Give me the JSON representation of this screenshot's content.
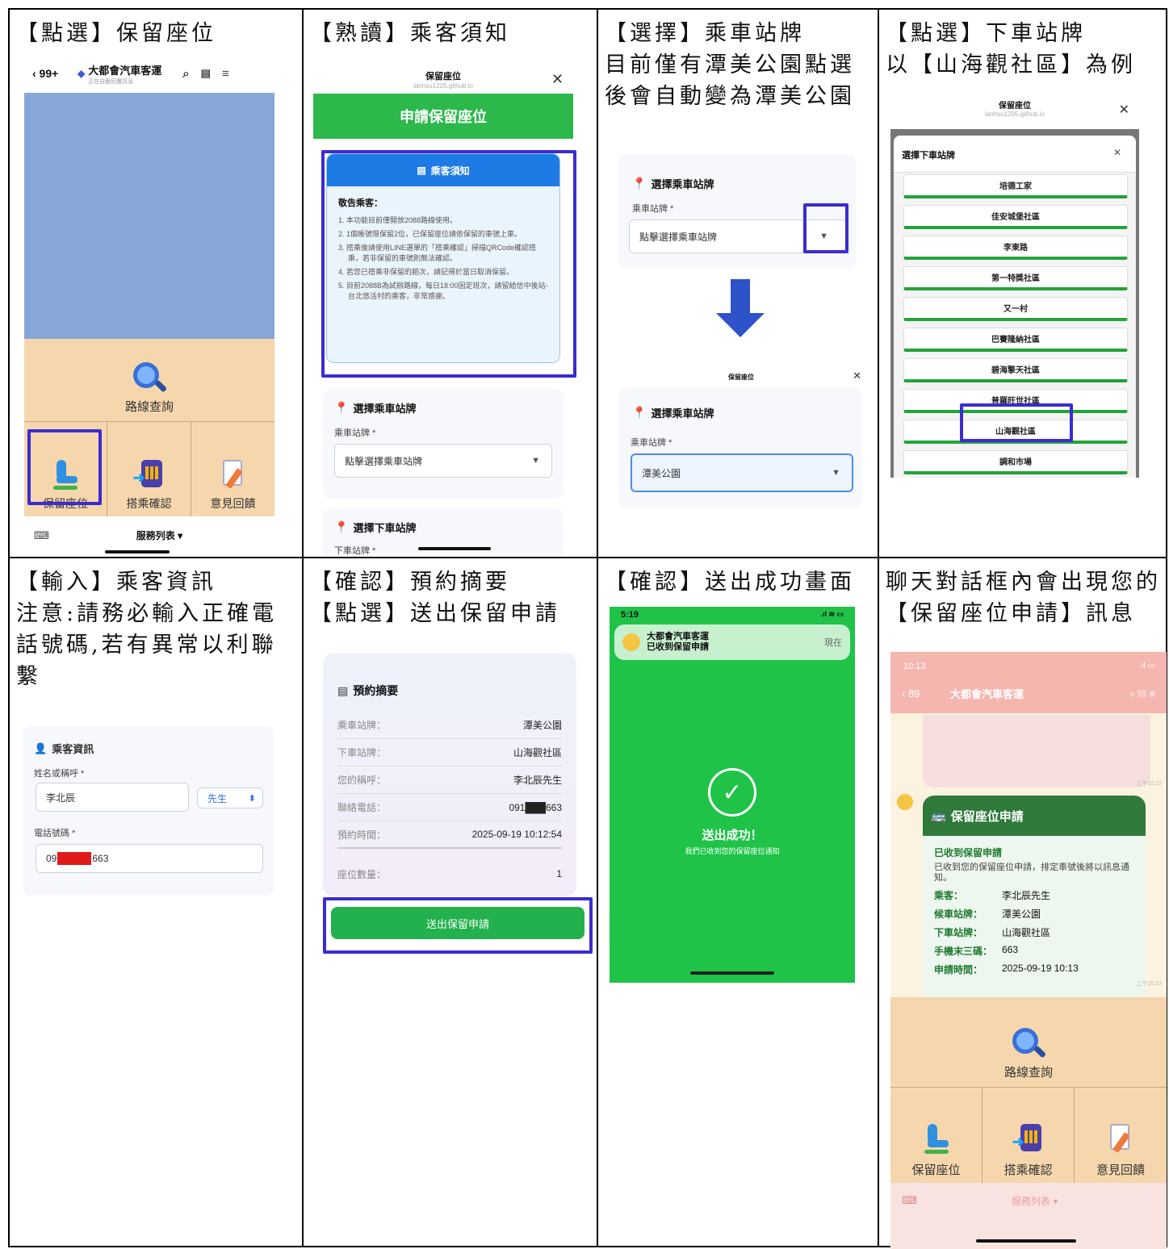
{
  "captions": {
    "c1": "【點選】保留座位",
    "c2": "【熟讀】乘客須知",
    "c3": "【選擇】乘車站牌\n目前僅有潭美公園點選後會自動變為潭美公園",
    "c4": "【點選】下車站牌\n以【山海觀社區】為例",
    "c5": "【輸入】乘客資訊\n注意:請務必輸入正確電話號碼,若有異常以利聯繫",
    "c6": "【確認】預約摘要\n【點選】送出保留申請",
    "c7": "【確認】送出成功畫面",
    "c8": "聊天對話框內會出現您的【保留座位申請】訊息"
  },
  "line_home": {
    "back": "‹ 99+",
    "account": "大都會汽車客運",
    "account_sub": "正在自動回覆訊息",
    "route_search": "路線查詢",
    "reserve": "保留座位",
    "boarding": "搭乘確認",
    "feedback": "意見回饋",
    "service_list": "服務列表 ▾"
  },
  "notice": {
    "modal_title": "保留座位",
    "modal_domain": "lanhsu1205.github.io",
    "header": "申請保留座位",
    "box_title": "乘客須知",
    "greeting": "敬告乘客：",
    "items": [
      "1. 本功能目前僅開放2088路線使用。",
      "2. 1個帳號限保留2位，已保留座位請依保留的車號上車。",
      "3. 搭乘後請使用LINE選單的「搭乘確認」掃描QRCode確認搭乘，若非保留的車號則無法確認。",
      "4. 若您已搭乘非保留的趟次，請記得於當日取消保留。",
      "5. 目前2088B為試辦路線，每日18:00固定班次，請留給信中後站-台北悠活村的乘客，非常感謝。"
    ],
    "board_section": "選擇乘車站牌",
    "board_label": "乘車站牌 *",
    "board_placeholder": "點擊選擇乘車站牌",
    "alight_section": "選擇下車站牌",
    "alight_label": "下車站牌 *"
  },
  "board_select": {
    "section": "選擇乘車站牌",
    "label": "乘車站牌 *",
    "placeholder": "點擊選擇乘車站牌",
    "modal_title": "保留座位",
    "selected": "潭美公園"
  },
  "alight_select": {
    "modal_title": "保留座位",
    "modal_domain": "lanhsu1205.github.io",
    "sheet_title": "選擇下車站牌",
    "stops": [
      "培德工家",
      "佳安城堡社區",
      "李東路",
      "第一特獎社區",
      "又一村",
      "巴賽隆納社區",
      "碧海擎天社區",
      "普羅旺世社區",
      "山海觀社區",
      "調和市場"
    ]
  },
  "passenger": {
    "section": "乘客資訊",
    "name_label": "姓名或稱呼 *",
    "name_value": "李北辰",
    "title_value": "先生",
    "phone_label": "電話號碼 *",
    "phone_prefix": "09",
    "phone_suffix": "663"
  },
  "summary": {
    "title": "預約摘要",
    "rows": [
      {
        "k": "乘車站牌：",
        "v": "潭美公園"
      },
      {
        "k": "下車站牌：",
        "v": "山海觀社區"
      },
      {
        "k": "您的稱呼：",
        "v": "李北辰先生"
      },
      {
        "k": "聯絡電話：",
        "v": "091███663"
      },
      {
        "k": "預約時間：",
        "v": "2025-09-19 10:12:54"
      }
    ],
    "seats_label": "座位數量：",
    "seats_value": "1",
    "submit": "送出保留申請"
  },
  "success": {
    "time": "5:19",
    "notif_app": "大都會汽車客運",
    "notif_msg": "已收到保留申請",
    "notif_time": "現在",
    "title": "送出成功！",
    "subtitle": "我們已收到您的保留座位通知"
  },
  "chat": {
    "time": "10:13",
    "back": "‹ 89",
    "account": "大都會汽車客運",
    "msg_time1": "上午10:12",
    "card_title": "保留座位申請",
    "received": "已收到保留申請",
    "desc": "已收到您的保留座位申請，排定車號後將以訊息通知。",
    "rows": [
      {
        "k": "乘客：",
        "v": "李北辰先生"
      },
      {
        "k": "候車站牌：",
        "v": "潭美公園"
      },
      {
        "k": "下車站牌：",
        "v": "山海觀社區"
      },
      {
        "k": "手機末三碼：",
        "v": "663"
      },
      {
        "k": "申請時間：",
        "v": "2025-09-19 10:13"
      }
    ],
    "msg_time2": "上午10:13",
    "route_search": "路線查詢",
    "reserve": "保留座位",
    "boarding": "搭乘確認",
    "feedback": "意見回饋",
    "service_list": "服務列表 ▾"
  },
  "colors": {
    "highlight": "#3b2bd1",
    "line_green": "#06c755",
    "header_green": "#2db84b",
    "blue": "#1e7be6"
  }
}
